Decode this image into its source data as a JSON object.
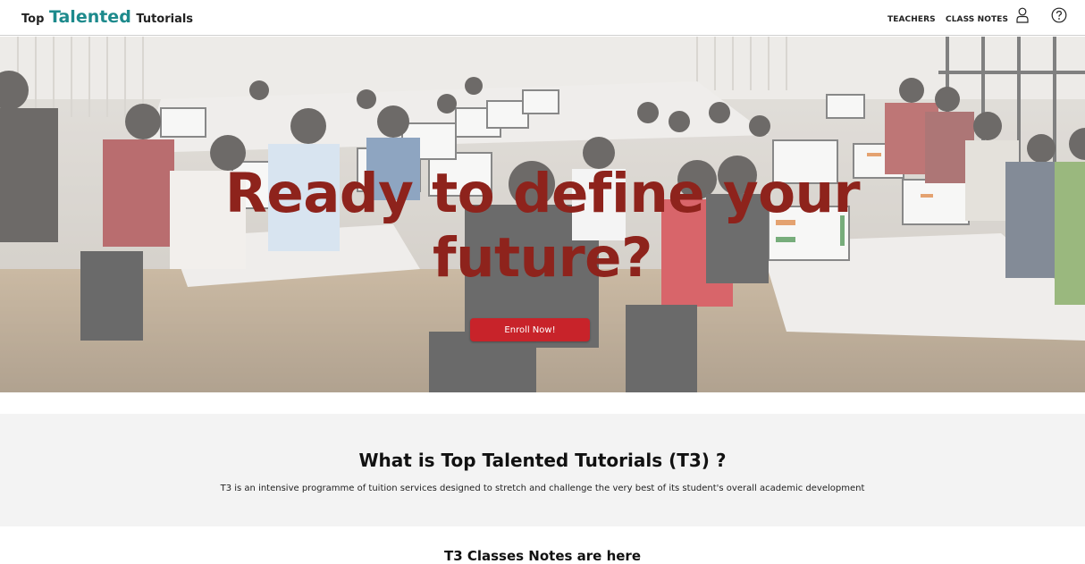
{
  "brand": {
    "prefix": "Top",
    "highlight": "Talented",
    "suffix": "Tutorials",
    "accent_color": "#1d8a8c"
  },
  "nav": {
    "teachers_label": "TEACHERS",
    "class_notes_label": "CLASS NOTES",
    "user_icon": "user-icon",
    "help_icon": "help-icon"
  },
  "hero": {
    "title_line1": "Ready to define your",
    "title_line2": "future?",
    "title_color": "#8e231c",
    "enroll_label": "Enroll Now!",
    "enroll_color": "#c8232a",
    "background": "classroom-group-photo"
  },
  "about": {
    "title": "What is Top Talented Tutorials (T3) ?",
    "description": "T3 is an intensive programme of tuition services designed to stretch and challenge the very best of its student's overall academic development"
  },
  "notes_section": {
    "title": "T3 Classes Notes are here"
  }
}
